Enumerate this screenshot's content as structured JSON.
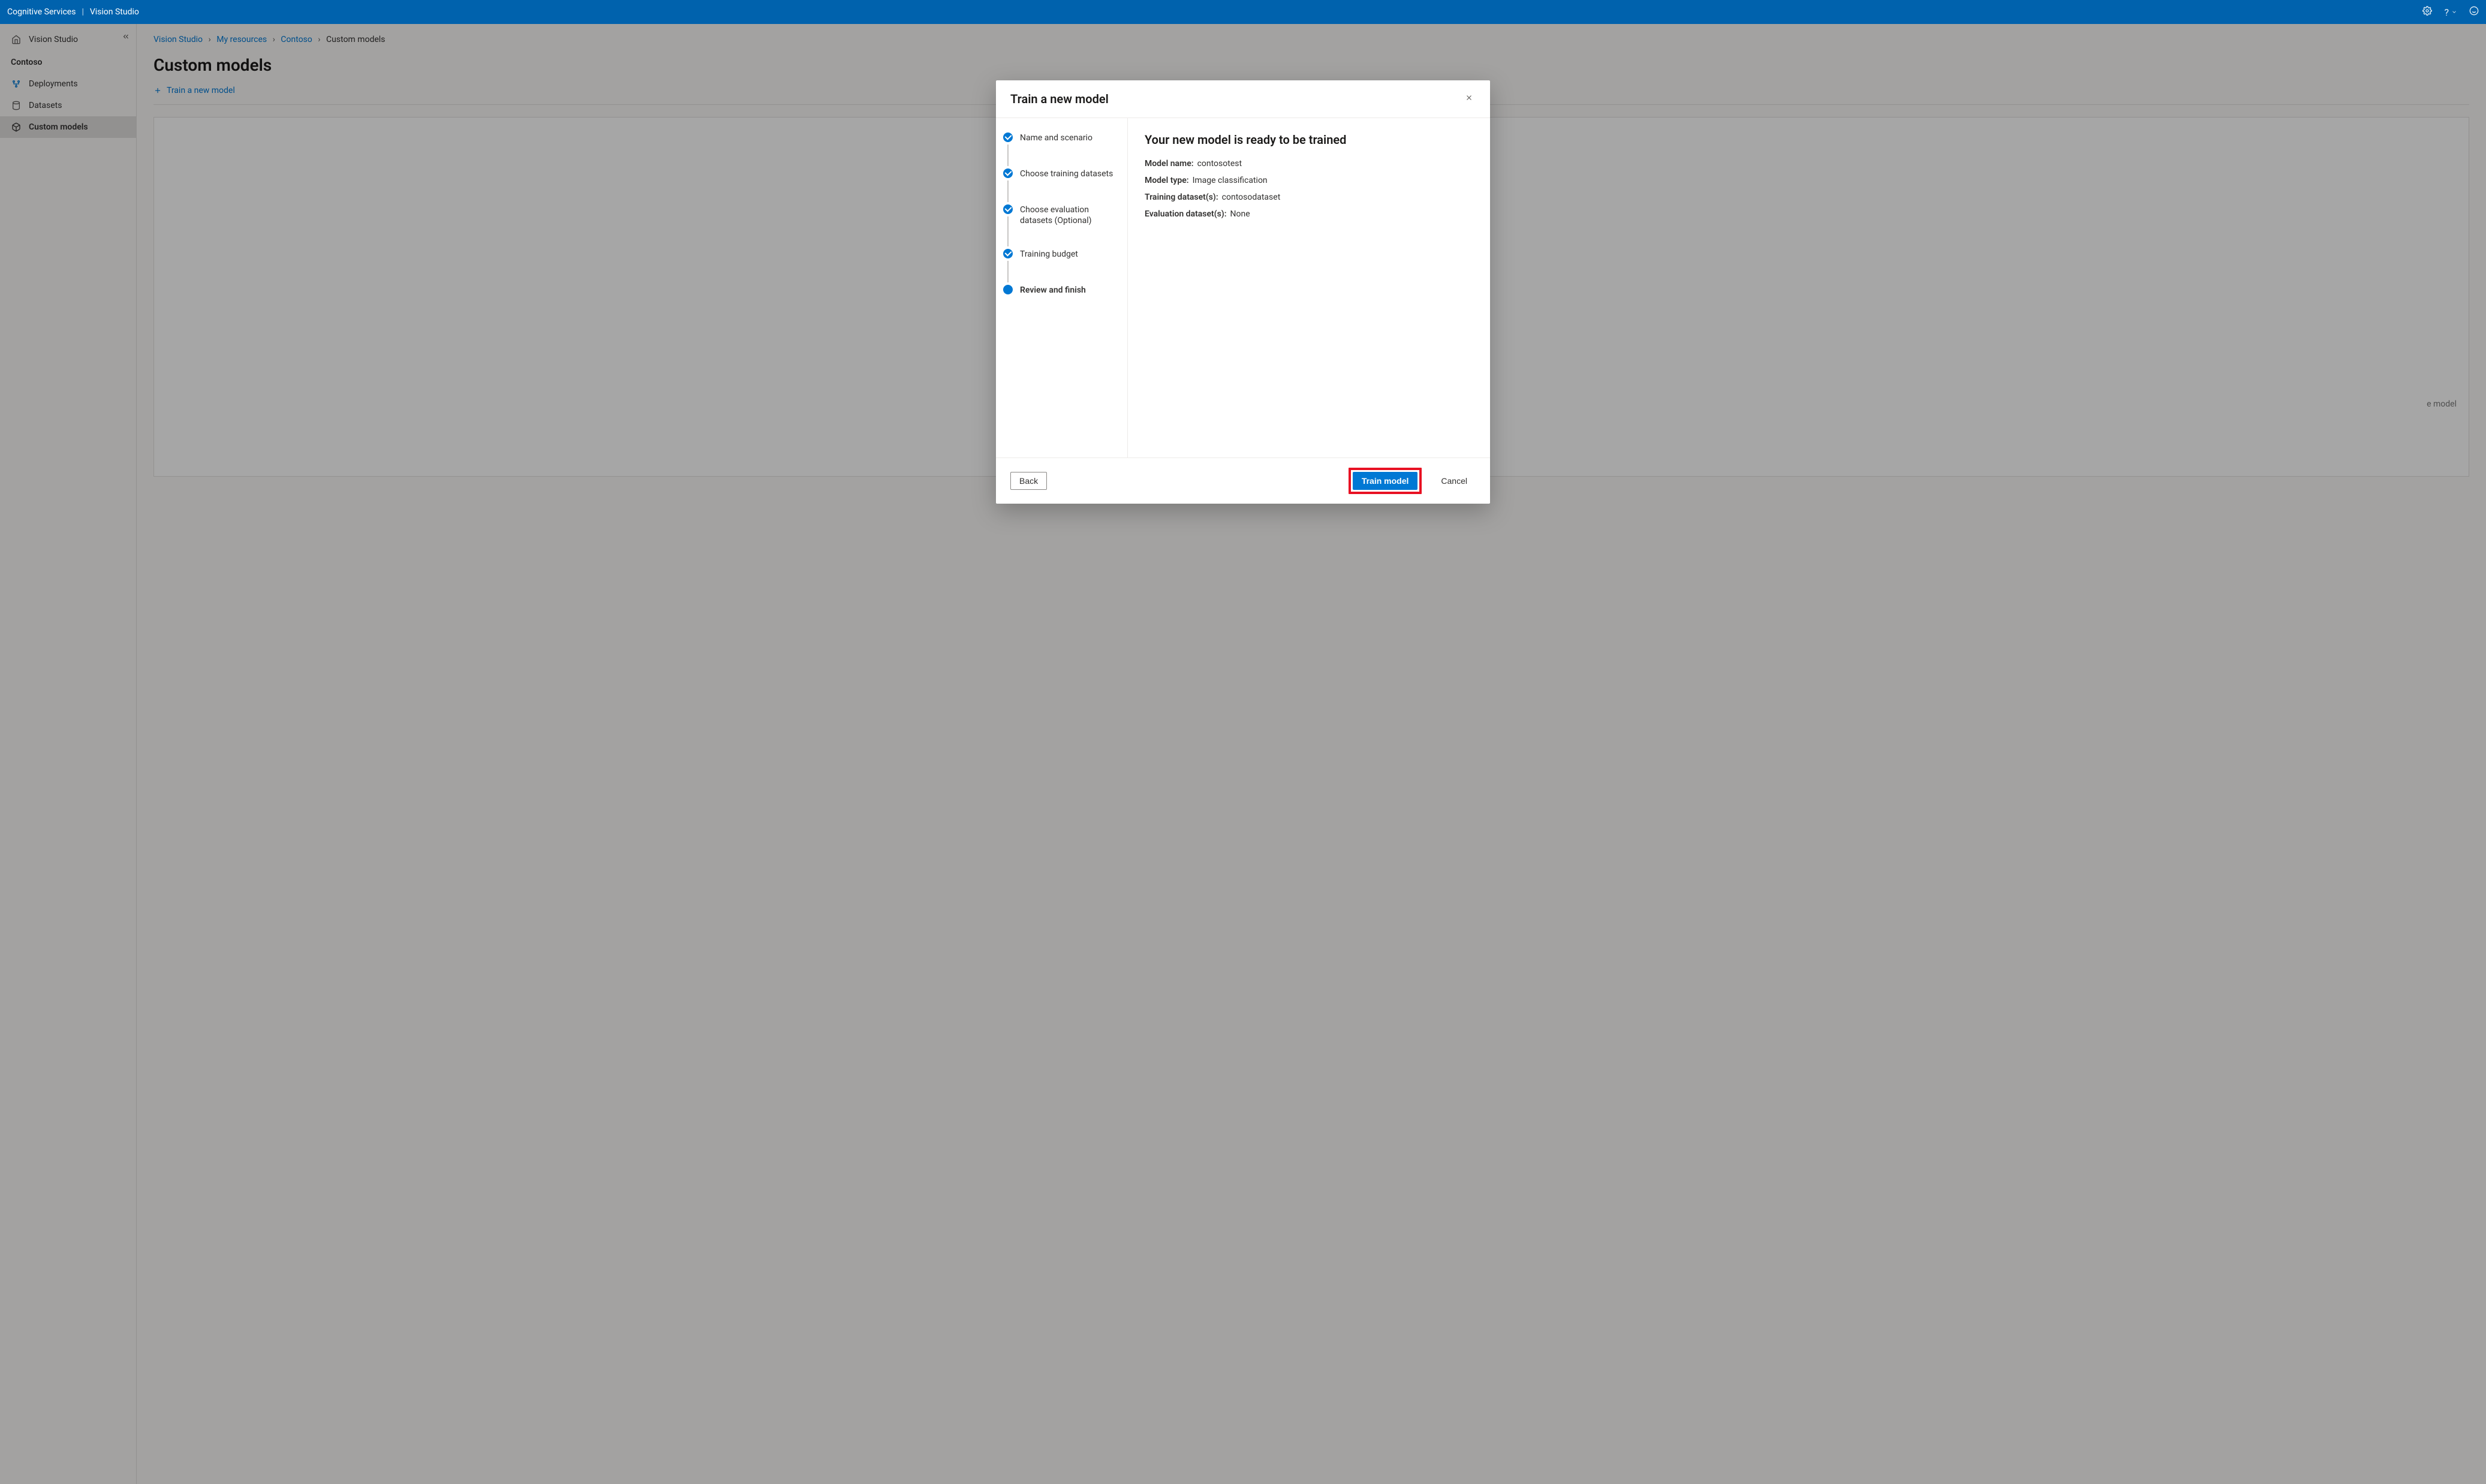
{
  "header": {
    "brand": "Cognitive Services",
    "section": "Vision Studio"
  },
  "sidebar": {
    "home": "Vision Studio",
    "resource": "Contoso",
    "items": [
      {
        "label": "Deployments"
      },
      {
        "label": "Datasets"
      },
      {
        "label": "Custom models"
      }
    ]
  },
  "breadcrumb": {
    "items": [
      "Vision Studio",
      "My resources",
      "Contoso",
      "Custom models"
    ]
  },
  "page": {
    "title": "Custom models",
    "train_action": "Train a new model",
    "hint_suffix": "e model"
  },
  "modal": {
    "title": "Train a new model",
    "steps": [
      {
        "label": "Name and scenario",
        "done": true
      },
      {
        "label": "Choose training datasets",
        "done": true
      },
      {
        "label": "Choose evaluation datasets (Optional)",
        "done": true
      },
      {
        "label": "Training budget",
        "done": true
      },
      {
        "label": "Review and finish",
        "current": true
      }
    ],
    "review": {
      "title": "Your new model is ready to be trained",
      "rows": [
        {
          "k": "Model name:",
          "v": "contosotest"
        },
        {
          "k": "Model type:",
          "v": "Image classification"
        },
        {
          "k": "Training dataset(s):",
          "v": "contosodataset"
        },
        {
          "k": "Evaluation dataset(s):",
          "v": "None"
        }
      ]
    },
    "buttons": {
      "back": "Back",
      "train": "Train model",
      "cancel": "Cancel"
    }
  }
}
